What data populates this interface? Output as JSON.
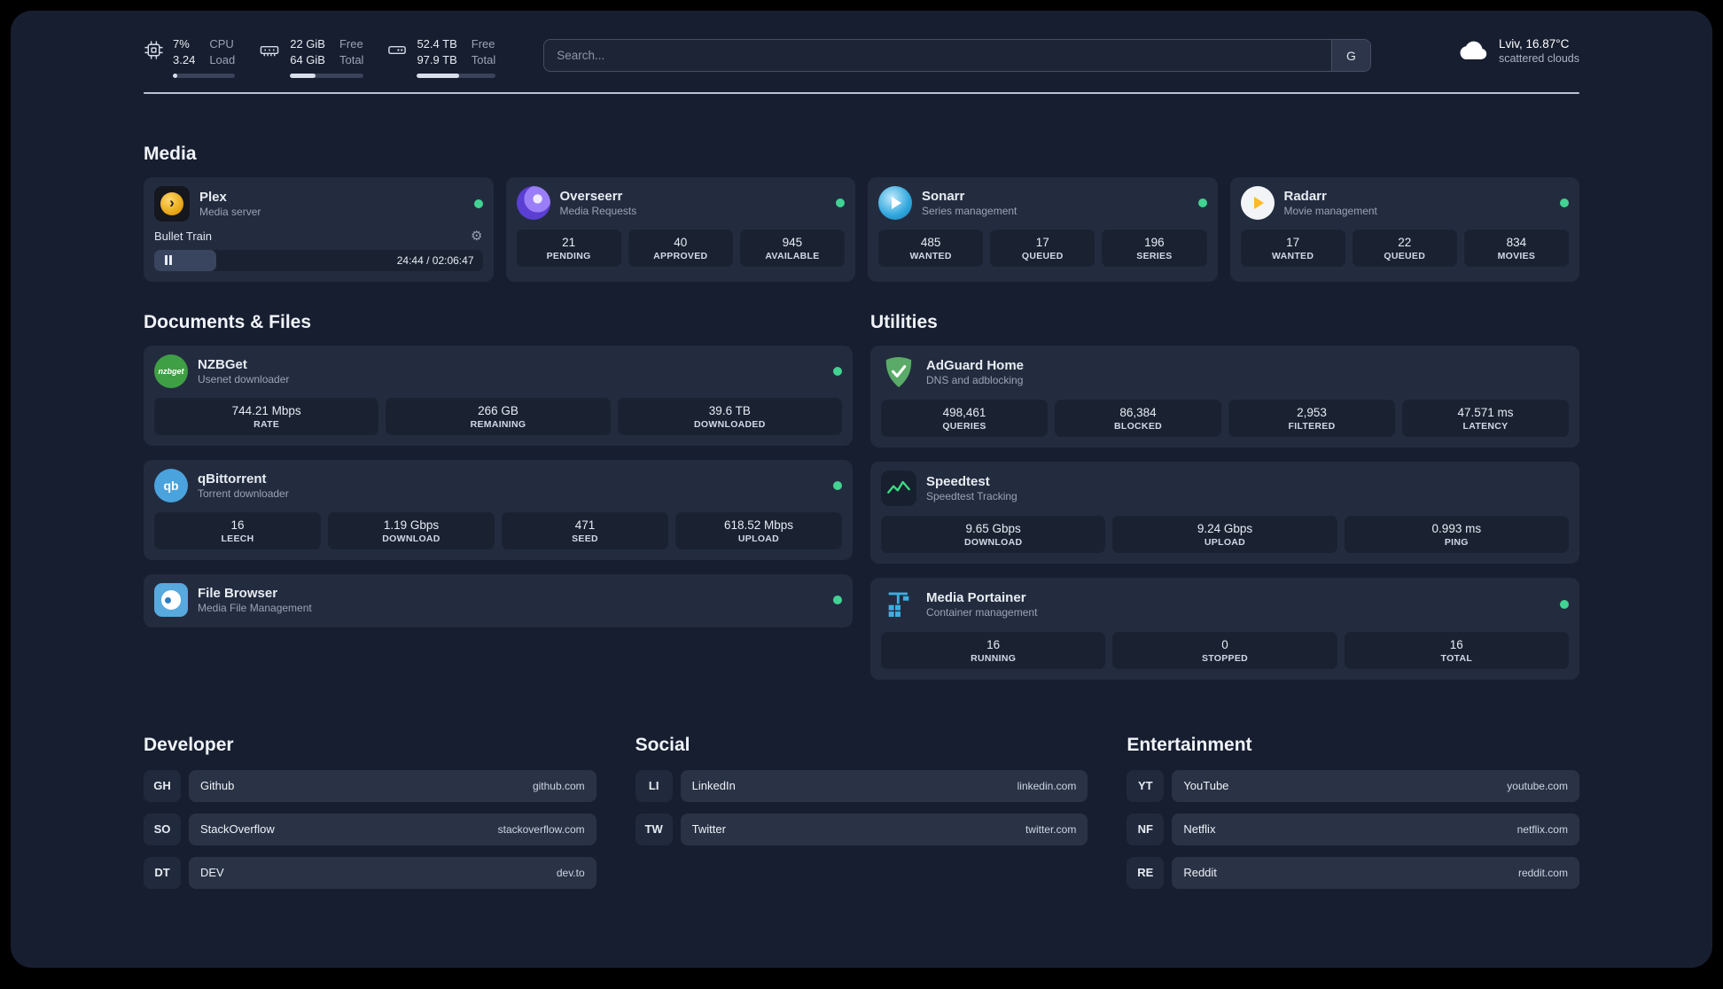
{
  "colors": {
    "background": "#171e30",
    "card": "#232c3f",
    "stat_box": "#1a2232",
    "status_online": "#41d392",
    "accent_plex": "#e5a00d",
    "accent_overseerr": "#5b3fd4",
    "accent_sonarr": "#2ea6dd",
    "accent_radarr": "#fdb927",
    "accent_nzbget": "#3f9f44",
    "accent_qbittorrent": "#4aa3dd",
    "accent_adguard": "#5bab68",
    "accent_speedtest": "#3ddc84",
    "accent_portainer": "#3bb0e0"
  },
  "icon_glyphs": {
    "plex": "›",
    "gear": "⚙",
    "nzbget": "nzbget",
    "qbittorrent": "qb"
  },
  "topbar": {
    "cpu": {
      "value": "7%",
      "label": "CPU",
      "value2": "3.24",
      "label2": "Load",
      "percent": 7
    },
    "memory": {
      "value": "22 GiB",
      "label": "Free",
      "value2": "64 GiB",
      "label2": "Total",
      "percent": 34
    },
    "disk": {
      "value": "52.4 TB",
      "label": "Free",
      "value2": "97.9 TB",
      "label2": "Total",
      "percent": 54
    },
    "search": {
      "placeholder": "Search...",
      "provider": "G"
    },
    "weather": {
      "location": "Lviv, 16.87°C",
      "condition": "scattered clouds"
    }
  },
  "media": {
    "title": "Media",
    "plex": {
      "name": "Plex",
      "subtitle": "Media server",
      "now_playing": "Bullet Train",
      "time": "24:44 / 02:06:47",
      "progress_percent": 19
    },
    "overseerr": {
      "name": "Overseerr",
      "subtitle": "Media Requests",
      "stats": [
        {
          "value": "21",
          "label": "PENDING"
        },
        {
          "value": "40",
          "label": "APPROVED"
        },
        {
          "value": "945",
          "label": "AVAILABLE"
        }
      ]
    },
    "sonarr": {
      "name": "Sonarr",
      "subtitle": "Series management",
      "stats": [
        {
          "value": "485",
          "label": "WANTED"
        },
        {
          "value": "17",
          "label": "QUEUED"
        },
        {
          "value": "196",
          "label": "SERIES"
        }
      ]
    },
    "radarr": {
      "name": "Radarr",
      "subtitle": "Movie management",
      "stats": [
        {
          "value": "17",
          "label": "WANTED"
        },
        {
          "value": "22",
          "label": "QUEUED"
        },
        {
          "value": "834",
          "label": "MOVIES"
        }
      ]
    }
  },
  "documents": {
    "title": "Documents & Files",
    "nzbget": {
      "name": "NZBGet",
      "subtitle": "Usenet downloader",
      "stats": [
        {
          "value": "744.21 Mbps",
          "label": "RATE"
        },
        {
          "value": "266 GB",
          "label": "REMAINING"
        },
        {
          "value": "39.6 TB",
          "label": "DOWNLOADED"
        }
      ]
    },
    "qbittorrent": {
      "name": "qBittorrent",
      "subtitle": "Torrent downloader",
      "stats": [
        {
          "value": "16",
          "label": "LEECH"
        },
        {
          "value": "1.19 Gbps",
          "label": "DOWNLOAD"
        },
        {
          "value": "471",
          "label": "SEED"
        },
        {
          "value": "618.52 Mbps",
          "label": "UPLOAD"
        }
      ]
    },
    "filebrowser": {
      "name": "File Browser",
      "subtitle": "Media File Management"
    }
  },
  "utilities": {
    "title": "Utilities",
    "adguard": {
      "name": "AdGuard Home",
      "subtitle": "DNS and adblocking",
      "stats": [
        {
          "value": "498,461",
          "label": "QUERIES"
        },
        {
          "value": "86,384",
          "label": "BLOCKED"
        },
        {
          "value": "2,953",
          "label": "FILTERED"
        },
        {
          "value": "47.571 ms",
          "label": "LATENCY"
        }
      ]
    },
    "speedtest": {
      "name": "Speedtest",
      "subtitle": "Speedtest Tracking",
      "stats": [
        {
          "value": "9.65 Gbps",
          "label": "DOWNLOAD"
        },
        {
          "value": "9.24 Gbps",
          "label": "UPLOAD"
        },
        {
          "value": "0.993 ms",
          "label": "PING"
        }
      ]
    },
    "portainer": {
      "name": "Media Portainer",
      "subtitle": "Container management",
      "stats": [
        {
          "value": "16",
          "label": "RUNNING"
        },
        {
          "value": "0",
          "label": "STOPPED"
        },
        {
          "value": "16",
          "label": "TOTAL"
        }
      ]
    }
  },
  "bookmarks": {
    "developer": {
      "title": "Developer",
      "items": [
        {
          "abbr": "GH",
          "name": "Github",
          "url": "github.com"
        },
        {
          "abbr": "SO",
          "name": "StackOverflow",
          "url": "stackoverflow.com"
        },
        {
          "abbr": "DT",
          "name": "DEV",
          "url": "dev.to"
        }
      ]
    },
    "social": {
      "title": "Social",
      "items": [
        {
          "abbr": "LI",
          "name": "LinkedIn",
          "url": "linkedin.com"
        },
        {
          "abbr": "TW",
          "name": "Twitter",
          "url": "twitter.com"
        }
      ]
    },
    "entertainment": {
      "title": "Entertainment",
      "items": [
        {
          "abbr": "YT",
          "name": "YouTube",
          "url": "youtube.com"
        },
        {
          "abbr": "NF",
          "name": "Netflix",
          "url": "netflix.com"
        },
        {
          "abbr": "RE",
          "name": "Reddit",
          "url": "reddit.com"
        }
      ]
    }
  }
}
